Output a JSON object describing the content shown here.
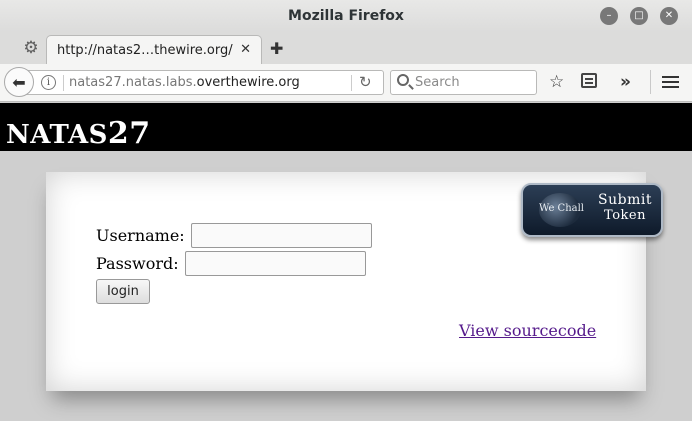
{
  "window": {
    "title": "Mozilla Firefox"
  },
  "tab": {
    "title": "http://natas2…thewire.org/"
  },
  "navbar": {
    "url_prefix": "natas27.natas.labs.",
    "url_domain": "overthewire.org",
    "search_placeholder": "Search"
  },
  "page": {
    "header_small": "NATAS",
    "header_num": "27",
    "username_label": "Username:",
    "password_label": "Password:",
    "login_label": "login",
    "source_link": "View sourcecode",
    "wechall": {
      "logo": "We Chall",
      "line1": "Submit",
      "line2": "Token"
    }
  },
  "colors": {
    "header_bg": "#000000",
    "page_bg": "#cfcfcf",
    "link": "#551a8b",
    "wechall_bg": "#1a2a3e"
  }
}
